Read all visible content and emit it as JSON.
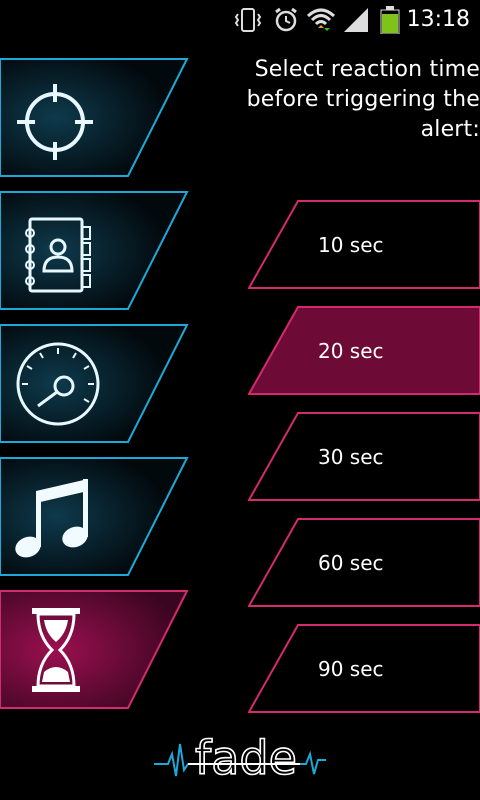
{
  "status_bar": {
    "time": "13:18"
  },
  "prompt": {
    "line1": "Select reaction time",
    "line2": "before triggering the",
    "line3": "alert:"
  },
  "options": [
    {
      "label": "10 sec",
      "selected": false
    },
    {
      "label": "20 sec",
      "selected": true
    },
    {
      "label": "30 sec",
      "selected": false
    },
    {
      "label": "60 sec",
      "selected": false
    },
    {
      "label": "90 sec",
      "selected": false
    }
  ],
  "left_icons": [
    "crosshair-icon",
    "address-book-icon",
    "speedometer-icon",
    "music-note-icon",
    "hourglass-icon"
  ],
  "selected_icon": "hourglass-icon",
  "logo": {
    "text": "fade"
  },
  "colors": {
    "cyan": "#1da9d8",
    "magenta": "#d42a6e",
    "magenta_fill": "#6d0a36"
  }
}
